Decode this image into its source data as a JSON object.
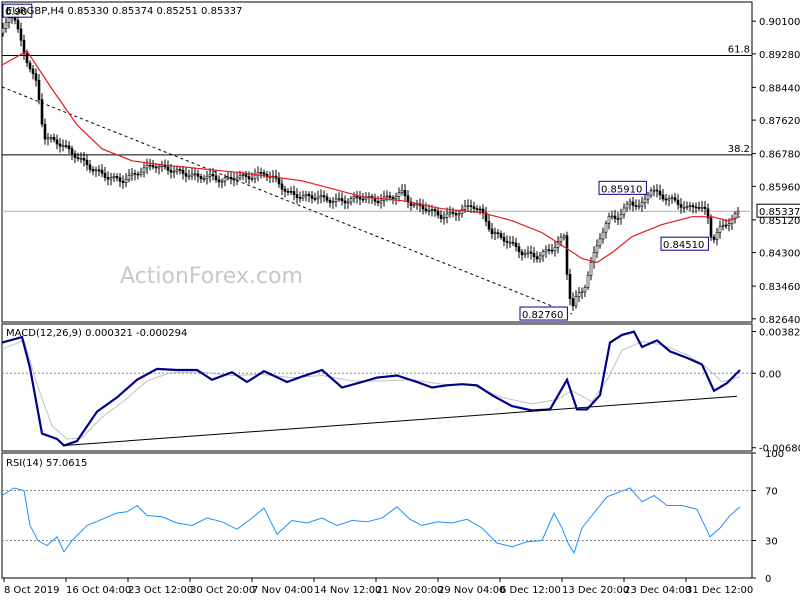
{
  "chart_data": [
    {
      "type": "candlestick",
      "title": "EURGBP,H4  0.85330 0.85374 0.85251 0.85337",
      "watermark": "ActionForex.com",
      "ylim": [
        0.8256,
        0.9058
      ],
      "y_ticks": [
        "0.90100",
        "0.89280",
        "0.88440",
        "0.87620",
        "0.86780",
        "0.85960",
        "0.85120",
        "0.84300",
        "0.83460",
        "0.82640"
      ],
      "current_price": "0.85337",
      "ma_color": "#e41a1c",
      "candle_color": "#000000",
      "fib_levels": [
        {
          "label": "61.8",
          "price": 0.8924
        },
        {
          "label": "38.2",
          "price": 0.8675
        }
      ],
      "price_path": [
        [
          0,
          0.898
        ],
        [
          10,
          0.904
        ],
        [
          22,
          0.893
        ],
        [
          35,
          0.885
        ],
        [
          42,
          0.872
        ],
        [
          52,
          0.871
        ],
        [
          60,
          0.87
        ],
        [
          75,
          0.867
        ],
        [
          90,
          0.864
        ],
        [
          105,
          0.862
        ],
        [
          120,
          0.861
        ],
        [
          135,
          0.863
        ],
        [
          150,
          0.865
        ],
        [
          165,
          0.864
        ],
        [
          180,
          0.863
        ],
        [
          195,
          0.862
        ],
        [
          210,
          0.862
        ],
        [
          220,
          0.861
        ],
        [
          235,
          0.862
        ],
        [
          250,
          0.862
        ],
        [
          262,
          0.863
        ],
        [
          275,
          0.861
        ],
        [
          285,
          0.858
        ],
        [
          300,
          0.857
        ],
        [
          315,
          0.857
        ],
        [
          330,
          0.856
        ],
        [
          345,
          0.856
        ],
        [
          360,
          0.857
        ],
        [
          375,
          0.856
        ],
        [
          390,
          0.857
        ],
        [
          400,
          0.858
        ],
        [
          410,
          0.855
        ],
        [
          425,
          0.854
        ],
        [
          440,
          0.852
        ],
        [
          455,
          0.853
        ],
        [
          470,
          0.855
        ],
        [
          480,
          0.853
        ],
        [
          490,
          0.848
        ],
        [
          505,
          0.846
        ],
        [
          520,
          0.843
        ],
        [
          535,
          0.842
        ],
        [
          550,
          0.844
        ],
        [
          562,
          0.847
        ],
        [
          566,
          0.835
        ],
        [
          570,
          0.829
        ],
        [
          575,
          0.832
        ],
        [
          582,
          0.834
        ],
        [
          590,
          0.841
        ],
        [
          598,
          0.847
        ],
        [
          608,
          0.852
        ],
        [
          618,
          0.852
        ],
        [
          628,
          0.856
        ],
        [
          638,
          0.854
        ],
        [
          648,
          0.859
        ],
        [
          660,
          0.857
        ],
        [
          672,
          0.856
        ],
        [
          685,
          0.854
        ],
        [
          695,
          0.855
        ],
        [
          705,
          0.853
        ],
        [
          710,
          0.846
        ],
        [
          718,
          0.849
        ],
        [
          728,
          0.851
        ],
        [
          738,
          0.8534
        ]
      ],
      "ma_path": [
        [
          0,
          0.89
        ],
        [
          25,
          0.8935
        ],
        [
          50,
          0.884
        ],
        [
          75,
          0.875
        ],
        [
          100,
          0.869
        ],
        [
          130,
          0.866
        ],
        [
          160,
          0.865
        ],
        [
          200,
          0.864
        ],
        [
          240,
          0.863
        ],
        [
          270,
          0.862
        ],
        [
          300,
          0.861
        ],
        [
          330,
          0.859
        ],
        [
          360,
          0.857
        ],
        [
          400,
          0.856
        ],
        [
          440,
          0.854
        ],
        [
          480,
          0.853
        ],
        [
          510,
          0.851
        ],
        [
          540,
          0.848
        ],
        [
          565,
          0.844
        ],
        [
          580,
          0.8415
        ],
        [
          595,
          0.8405
        ],
        [
          610,
          0.843
        ],
        [
          630,
          0.847
        ],
        [
          660,
          0.85
        ],
        [
          690,
          0.852
        ],
        [
          710,
          0.852
        ],
        [
          725,
          0.851
        ],
        [
          738,
          0.852
        ]
      ],
      "trend_line": [
        [
          0,
          0.8845
        ],
        [
          570,
          0.8276
        ]
      ],
      "annotations": [
        {
          "label": "0.90",
          "x": 1,
          "price": 0.9035,
          "align": "start"
        },
        {
          "label": "0.85910",
          "x": 597,
          "price": 0.8591,
          "align": "start"
        },
        {
          "label": "0.84510",
          "x": 659,
          "price": 0.8451,
          "align": "start"
        },
        {
          "label": "0.82760",
          "x": 518,
          "price": 0.8276,
          "align": "start"
        }
      ],
      "x_ticks": [
        "8 Oct 2019",
        "16 Oct 04:00",
        "23 Oct 12:00",
        "30 Oct 20:00",
        "7 Nov 04:00",
        "14 Nov 12:00",
        "21 Nov 20:00",
        "29 Nov 04:00",
        "6 Dec 12:00",
        "13 Dec 20:00",
        "23 Dec 04:00",
        "31 Dec 12:00"
      ]
    },
    {
      "type": "line",
      "title": "MACD(12,26,9) 0.000321 -0.000294",
      "ylim": [
        -0.0071,
        0.0045
      ],
      "y_ticks": [
        "0.00382",
        "0.00",
        "-0.006803"
      ],
      "zero_line": 0,
      "series": [
        {
          "color": "#00008b",
          "values": [
            [
              0,
              0.0028
            ],
            [
              20,
              0.0033
            ],
            [
              28,
              0.0005
            ],
            [
              40,
              -0.0055
            ],
            [
              55,
              -0.006
            ],
            [
              62,
              -0.0066
            ],
            [
              75,
              -0.0062
            ],
            [
              95,
              -0.0035
            ],
            [
              115,
              -0.0022
            ],
            [
              135,
              -0.0006
            ],
            [
              155,
              0.0004
            ],
            [
              175,
              0.0003
            ],
            [
              195,
              0.0003
            ],
            [
              210,
              -0.0006
            ],
            [
              230,
              0.0001
            ],
            [
              245,
              -0.0008
            ],
            [
              262,
              0.0002
            ],
            [
              285,
              -0.0008
            ],
            [
              300,
              -0.0003
            ],
            [
              320,
              0.0003
            ],
            [
              340,
              -0.0013
            ],
            [
              360,
              -0.0008
            ],
            [
              375,
              -0.0004
            ],
            [
              395,
              -0.0002
            ],
            [
              415,
              -0.0008
            ],
            [
              430,
              -0.0013
            ],
            [
              445,
              -0.0011
            ],
            [
              460,
              -0.001
            ],
            [
              475,
              -0.0011
            ],
            [
              490,
              -0.002
            ],
            [
              510,
              -0.003
            ],
            [
              530,
              -0.0034
            ],
            [
              548,
              -0.0033
            ],
            [
              565,
              -0.0006
            ],
            [
              575,
              -0.0033
            ],
            [
              585,
              -0.0033
            ],
            [
              598,
              -0.002
            ],
            [
              608,
              0.0028
            ],
            [
              620,
              0.0035
            ],
            [
              632,
              0.0038
            ],
            [
              640,
              0.0024
            ],
            [
              655,
              0.003
            ],
            [
              668,
              0.002
            ],
            [
              685,
              0.0014
            ],
            [
              700,
              0.0008
            ],
            [
              712,
              -0.0016
            ],
            [
              725,
              -0.0009
            ],
            [
              738,
              0.0003
            ]
          ]
        },
        {
          "color": "#c0c0c0",
          "values": [
            [
              0,
              0.0022
            ],
            [
              22,
              0.003
            ],
            [
              35,
              -0.001
            ],
            [
              50,
              -0.0048
            ],
            [
              65,
              -0.006
            ],
            [
              80,
              -0.0059
            ],
            [
              100,
              -0.004
            ],
            [
              125,
              -0.0023
            ],
            [
              145,
              -0.0007
            ],
            [
              170,
              0.0001
            ],
            [
              200,
              0.0001
            ],
            [
              230,
              -0.0002
            ],
            [
              260,
              -0.0001
            ],
            [
              290,
              -0.0004
            ],
            [
              320,
              -0.0002
            ],
            [
              350,
              -0.0007
            ],
            [
              380,
              -0.0007
            ],
            [
              410,
              -0.0006
            ],
            [
              440,
              -0.001
            ],
            [
              470,
              -0.0011
            ],
            [
              500,
              -0.0022
            ],
            [
              530,
              -0.0028
            ],
            [
              555,
              -0.0024
            ],
            [
              570,
              -0.0016
            ],
            [
              590,
              -0.0026
            ],
            [
              605,
              -0.0006
            ],
            [
              620,
              0.0021
            ],
            [
              640,
              0.0029
            ],
            [
              660,
              0.0026
            ],
            [
              685,
              0.0017
            ],
            [
              705,
              0.0005
            ],
            [
              720,
              -0.0008
            ],
            [
              738,
              -0.0003
            ]
          ]
        }
      ],
      "trend_line": [
        [
          62,
          -0.0066
        ],
        [
          735,
          -0.0021
        ]
      ]
    },
    {
      "type": "line",
      "title": "RSI(14) 57.0615",
      "ylim": [
        0,
        100
      ],
      "y_ticks": [
        "100",
        "70",
        "30",
        "0"
      ],
      "levels": [
        70,
        30
      ],
      "series": [
        {
          "color": "#1e90ff",
          "values": [
            [
              0,
              66
            ],
            [
              12,
              72
            ],
            [
              22,
              70
            ],
            [
              28,
              42
            ],
            [
              36,
              30
            ],
            [
              45,
              26
            ],
            [
              55,
              33
            ],
            [
              62,
              21
            ],
            [
              70,
              30
            ],
            [
              85,
              42
            ],
            [
              100,
              47
            ],
            [
              115,
              52
            ],
            [
              125,
              53
            ],
            [
              135,
              58
            ],
            [
              145,
              50
            ],
            [
              160,
              49
            ],
            [
              175,
              44
            ],
            [
              190,
              42
            ],
            [
              205,
              48
            ],
            [
              220,
              45
            ],
            [
              235,
              39
            ],
            [
              250,
              48
            ],
            [
              262,
              56
            ],
            [
              275,
              35
            ],
            [
              290,
              46
            ],
            [
              305,
              44
            ],
            [
              320,
              48
            ],
            [
              335,
              42
            ],
            [
              350,
              46
            ],
            [
              365,
              45
            ],
            [
              380,
              48
            ],
            [
              395,
              57
            ],
            [
              408,
              47
            ],
            [
              420,
              42
            ],
            [
              435,
              45
            ],
            [
              450,
              44
            ],
            [
              465,
              47
            ],
            [
              480,
              40
            ],
            [
              495,
              28
            ],
            [
              510,
              25
            ],
            [
              525,
              29
            ],
            [
              540,
              30
            ],
            [
              552,
              52
            ],
            [
              560,
              40
            ],
            [
              566,
              28
            ],
            [
              572,
              20
            ],
            [
              580,
              40
            ],
            [
              592,
              52
            ],
            [
              605,
              65
            ],
            [
              618,
              69
            ],
            [
              628,
              72
            ],
            [
              640,
              61
            ],
            [
              652,
              66
            ],
            [
              665,
              58
            ],
            [
              680,
              58
            ],
            [
              695,
              55
            ],
            [
              708,
              33
            ],
            [
              718,
              40
            ],
            [
              728,
              50
            ],
            [
              738,
              57
            ]
          ]
        }
      ]
    }
  ]
}
